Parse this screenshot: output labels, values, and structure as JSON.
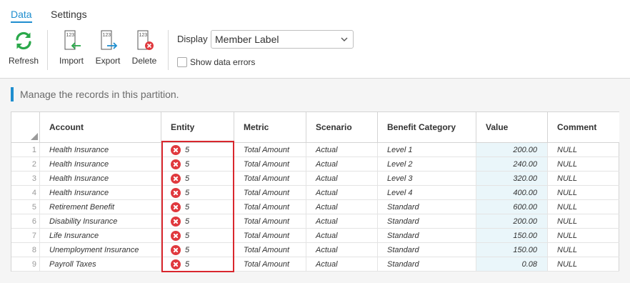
{
  "tabs": [
    {
      "label": "Data",
      "active": true
    },
    {
      "label": "Settings",
      "active": false
    }
  ],
  "toolbar": {
    "refresh": {
      "label": "Refresh",
      "icon": "refresh-icon"
    },
    "import": {
      "label": "Import",
      "icon": "import-icon",
      "glyph": "123"
    },
    "export": {
      "label": "Export",
      "icon": "export-icon",
      "glyph": "123"
    },
    "delete": {
      "label": "Delete",
      "icon": "delete-icon",
      "glyph": "123"
    },
    "display_label": "Display",
    "display_value": "Member Label",
    "show_errors_label": "Show data errors",
    "show_errors_checked": false
  },
  "intro": "Manage the records in this partition.",
  "grid": {
    "columns": [
      "Account",
      "Entity",
      "Metric",
      "Scenario",
      "Benefit Category",
      "Value",
      "Comment"
    ],
    "rows": [
      {
        "num": "1",
        "account": "Health Insurance",
        "entity": "5",
        "entity_error": true,
        "metric": "Total Amount",
        "scenario": "Actual",
        "category": "Level 1",
        "value": "200.00",
        "comment": "NULL"
      },
      {
        "num": "2",
        "account": "Health Insurance",
        "entity": "5",
        "entity_error": true,
        "metric": "Total Amount",
        "scenario": "Actual",
        "category": "Level 2",
        "value": "240.00",
        "comment": "NULL"
      },
      {
        "num": "3",
        "account": "Health Insurance",
        "entity": "5",
        "entity_error": true,
        "metric": "Total Amount",
        "scenario": "Actual",
        "category": "Level 3",
        "value": "320.00",
        "comment": "NULL"
      },
      {
        "num": "4",
        "account": "Health Insurance",
        "entity": "5",
        "entity_error": true,
        "metric": "Total Amount",
        "scenario": "Actual",
        "category": "Level 4",
        "value": "400.00",
        "comment": "NULL"
      },
      {
        "num": "5",
        "account": "Retirement Benefit",
        "entity": "5",
        "entity_error": true,
        "metric": "Total Amount",
        "scenario": "Actual",
        "category": "Standard",
        "value": "600.00",
        "comment": "NULL"
      },
      {
        "num": "6",
        "account": "Disability Insurance",
        "entity": "5",
        "entity_error": true,
        "metric": "Total Amount",
        "scenario": "Actual",
        "category": "Standard",
        "value": "200.00",
        "comment": "NULL"
      },
      {
        "num": "7",
        "account": "Life Insurance",
        "entity": "5",
        "entity_error": true,
        "metric": "Total Amount",
        "scenario": "Actual",
        "category": "Standard",
        "value": "150.00",
        "comment": "NULL"
      },
      {
        "num": "8",
        "account": "Unemployment Insurance",
        "entity": "5",
        "entity_error": true,
        "metric": "Total Amount",
        "scenario": "Actual",
        "category": "Standard",
        "value": "150.00",
        "comment": "NULL"
      },
      {
        "num": "9",
        "account": "Payroll Taxes",
        "entity": "5",
        "entity_error": true,
        "metric": "Total Amount",
        "scenario": "Actual",
        "category": "Standard",
        "value": "0.08",
        "comment": "NULL"
      }
    ]
  },
  "colors": {
    "accent": "#1f8ecf",
    "refresh_green": "#2aa84a",
    "export_blue": "#1f8ecf",
    "import_green": "#2aa84a",
    "error_red": "#e0393e",
    "highlight_red": "#d9272e",
    "value_bg": "#eaf6fa"
  }
}
